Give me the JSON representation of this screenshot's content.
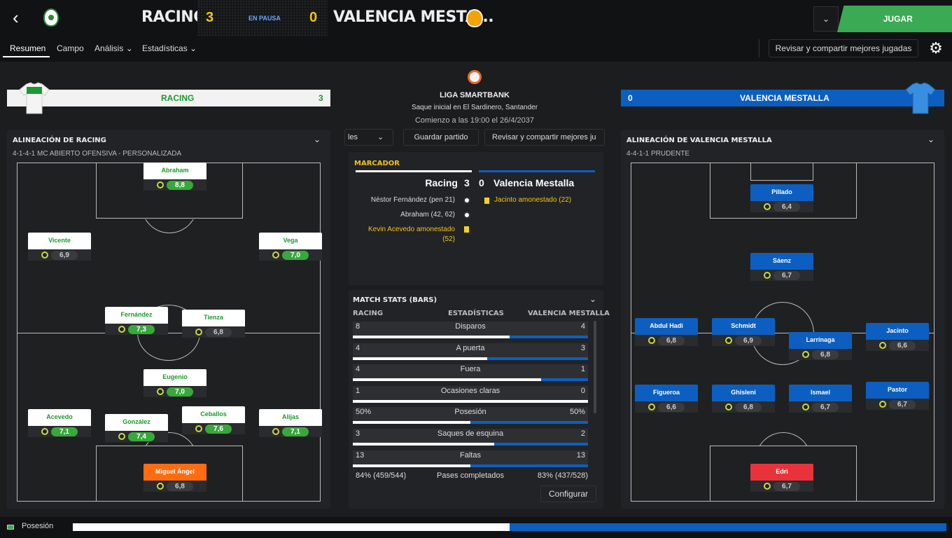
{
  "header": {
    "back_icon": "arrow-back-icon",
    "home_team": "RACING",
    "home_score": "3",
    "status": "EN PAUSA",
    "away_score": "0",
    "away_team": "VALENCIA MESTA...",
    "play_label": "JUGAR"
  },
  "tabs": [
    {
      "label": "Resumen"
    },
    {
      "label": "Campo"
    },
    {
      "label": "Análisis"
    },
    {
      "label": "Estadísticas"
    }
  ],
  "share_label": "Revisar y compartir mejores jugadas",
  "home_panel": {
    "team": "RACING",
    "score": "3",
    "lineup_title": "ALINEACIÓN DE RACING",
    "formation": "4-1-4-1 MC ABIERTO OFENSIVA - PERSONALIZADA"
  },
  "away_panel": {
    "team": "VALENCIA MESTALLA",
    "score": "0",
    "lineup_title": "ALINEACIÓN DE VALENCIA MESTALLA",
    "formation": "4-4-1-1 PRUDENTE"
  },
  "home_players": [
    {
      "name": "Abraham",
      "rating": "8,8",
      "high": true
    },
    {
      "name": "Vicente",
      "rating": "6,9",
      "high": false
    },
    {
      "name": "Vega",
      "rating": "7,0",
      "high": true
    },
    {
      "name": "Fernández",
      "rating": "7,3",
      "high": true
    },
    {
      "name": "Tienza",
      "rating": "6,8",
      "high": false
    },
    {
      "name": "Eugenio",
      "rating": "7,0",
      "high": true
    },
    {
      "name": "Acevedo",
      "rating": "7,1",
      "high": true
    },
    {
      "name": "González",
      "rating": "7,4",
      "high": true
    },
    {
      "name": "Ceballos",
      "rating": "7,6",
      "high": true
    },
    {
      "name": "Alijas",
      "rating": "7,1",
      "high": true
    },
    {
      "name": "Miguel Ángel",
      "rating": "6,8",
      "high": false
    }
  ],
  "away_players": [
    {
      "name": "Pillado",
      "rating": "6,4"
    },
    {
      "name": "Sáenz",
      "rating": "6,7"
    },
    {
      "name": "Abdul Hadi",
      "rating": "6,8"
    },
    {
      "name": "Schmidt",
      "rating": "6,9"
    },
    {
      "name": "Larrinaga",
      "rating": "6,8"
    },
    {
      "name": "Jacinto",
      "rating": "6,6"
    },
    {
      "name": "Figueroa",
      "rating": "6,6"
    },
    {
      "name": "Ghisleni",
      "rating": "6,8"
    },
    {
      "name": "Ismael",
      "rating": "6,7"
    },
    {
      "name": "Pastor",
      "rating": "6,7"
    },
    {
      "name": "Edri",
      "rating": "6,7"
    }
  ],
  "match_info": {
    "league": "LIGA SMARTBANK",
    "kickoff": "Saque inicial en El Sardinero, Santander",
    "start": "Comienzo a las 19:00 el 26/4/2037"
  },
  "mid_buttons": {
    "left_cut": "les",
    "save": "Guardar partido",
    "share_cut": "Revisar y compartir mejores ju"
  },
  "scoreboard": {
    "title": "MARCADOR",
    "home": "Racing",
    "home_score": "3",
    "away_score": "0",
    "away": "Valencia Mestalla",
    "home_events": [
      {
        "text": "Néstor Fernández (pen 21)",
        "icon": "ball-icon"
      },
      {
        "text": "Abraham (42, 62)",
        "icon": "ball-icon"
      },
      {
        "text": "Kevin Acevedo amonestado",
        "text2": "(52)",
        "icon": "yellow-card-icon"
      }
    ],
    "away_events": [
      {
        "text": "Jacinto amonestado (22)",
        "icon": "yellow-card-icon"
      }
    ]
  },
  "stats": {
    "title": "MATCH STATS (BARS)",
    "col_home": "RACING",
    "col_mid": "ESTADÍSTICAS",
    "col_away": "VALENCIA MESTALLA",
    "rows": [
      {
        "home": "8",
        "label": "Disparos",
        "away": "4",
        "home_share": 0.667
      },
      {
        "home": "4",
        "label": "A puerta",
        "away": "3",
        "home_share": 0.571
      },
      {
        "home": "4",
        "label": "Fuera",
        "away": "1",
        "home_share": 0.8
      },
      {
        "home": "1",
        "label": "Ocasiones claras",
        "away": "0",
        "home_share": 1.0
      },
      {
        "home": "50%",
        "label": "Posesión",
        "away": "50%",
        "home_share": 0.5
      },
      {
        "home": "3",
        "label": "Saques de esquina",
        "away": "2",
        "home_share": 0.6
      },
      {
        "home": "13",
        "label": "Faltas",
        "away": "13",
        "home_share": 0.5
      }
    ],
    "passes": {
      "home": "84% (459/544)",
      "label": "Pases completados",
      "away": "83% (437/528)"
    },
    "config": "Configurar"
  },
  "possession": {
    "label": "Posesión",
    "home_share": 0.5
  }
}
